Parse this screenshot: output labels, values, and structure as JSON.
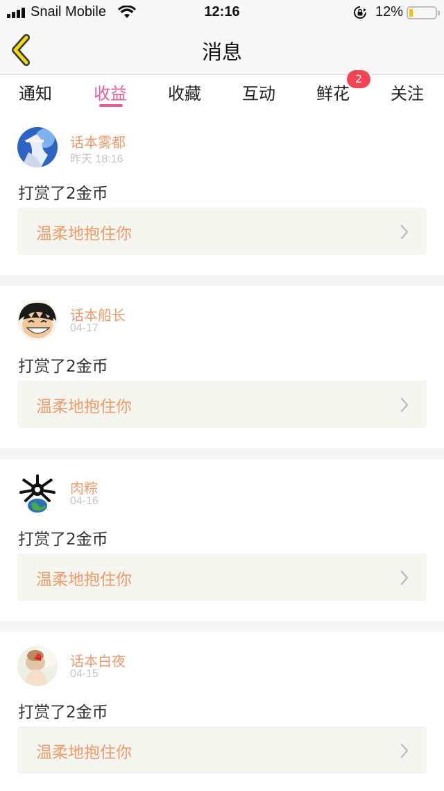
{
  "status_bar": {
    "carrier": "Snail Mobile",
    "time": "12:16",
    "battery_percent": "12%",
    "battery_level": 0.12,
    "icons": [
      "signal-icon",
      "wifi-icon",
      "rotation-lock-icon",
      "battery-icon"
    ]
  },
  "nav": {
    "title": "消息",
    "back_icon": "chevron-left-icon"
  },
  "tabs": [
    {
      "label": "通知"
    },
    {
      "label": "收益",
      "active": true
    },
    {
      "label": "收藏"
    },
    {
      "label": "互动"
    },
    {
      "label": "鲜花",
      "badge": "2"
    },
    {
      "label": "关注"
    }
  ],
  "items": [
    {
      "user": "话本雾都",
      "time": "昨天 18:16",
      "message": "打赏了2金币",
      "work": "温柔地抱住你"
    },
    {
      "user": "话本船长",
      "time": "04-17",
      "message": "打赏了2金币",
      "work": "温柔地抱住你"
    },
    {
      "user": "肉粽",
      "time": "04-16",
      "message": "打赏了2金币",
      "work": "温柔地抱住你"
    },
    {
      "user": "话本白夜",
      "time": "04-15",
      "message": "打赏了2金币",
      "work": "温柔地抱住你"
    }
  ],
  "colors": {
    "accent": "#e85c9a",
    "name_orange": "#ef9a6a",
    "badge_red": "#f24452",
    "card_link_bg": "#f5f5ef",
    "back_icon_yellow": "#f3d80f"
  }
}
